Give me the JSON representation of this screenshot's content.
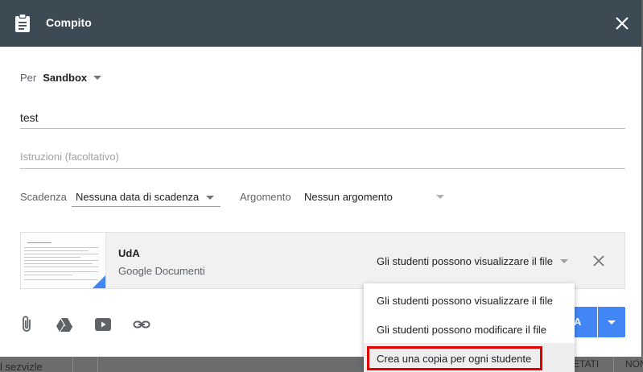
{
  "dialog": {
    "title": "Compito",
    "for_label": "Per",
    "class_name": "Sandbox",
    "title_value": "test",
    "instructions_placeholder": "Istruzioni (facoltativo)",
    "due_label": "Scadenza",
    "due_value": "Nessuna data di scadenza",
    "topic_label": "Argomento",
    "topic_value": "Nessun argomento"
  },
  "attachment": {
    "name": "UdA",
    "type": "Google Documenti",
    "permission": "Gli studenti possono visualizzare il file"
  },
  "assign_button": {
    "label": "A"
  },
  "menu": {
    "items": [
      {
        "label": "Gli studenti possono visualizzare il file"
      },
      {
        "label": "Gli studenti possono modificare il file"
      },
      {
        "label": "Crea una copia per ogni studente"
      }
    ]
  },
  "background": {
    "left_text": "l sezvizle",
    "col1": "ETATI",
    "col2": "NON"
  },
  "colors": {
    "header": "#3c4a54",
    "accent": "#4285f4",
    "highlight_border": "#e00000"
  },
  "icons": [
    "assignment-icon",
    "close-icon",
    "paperclip-icon",
    "drive-icon",
    "youtube-icon",
    "link-icon"
  ]
}
